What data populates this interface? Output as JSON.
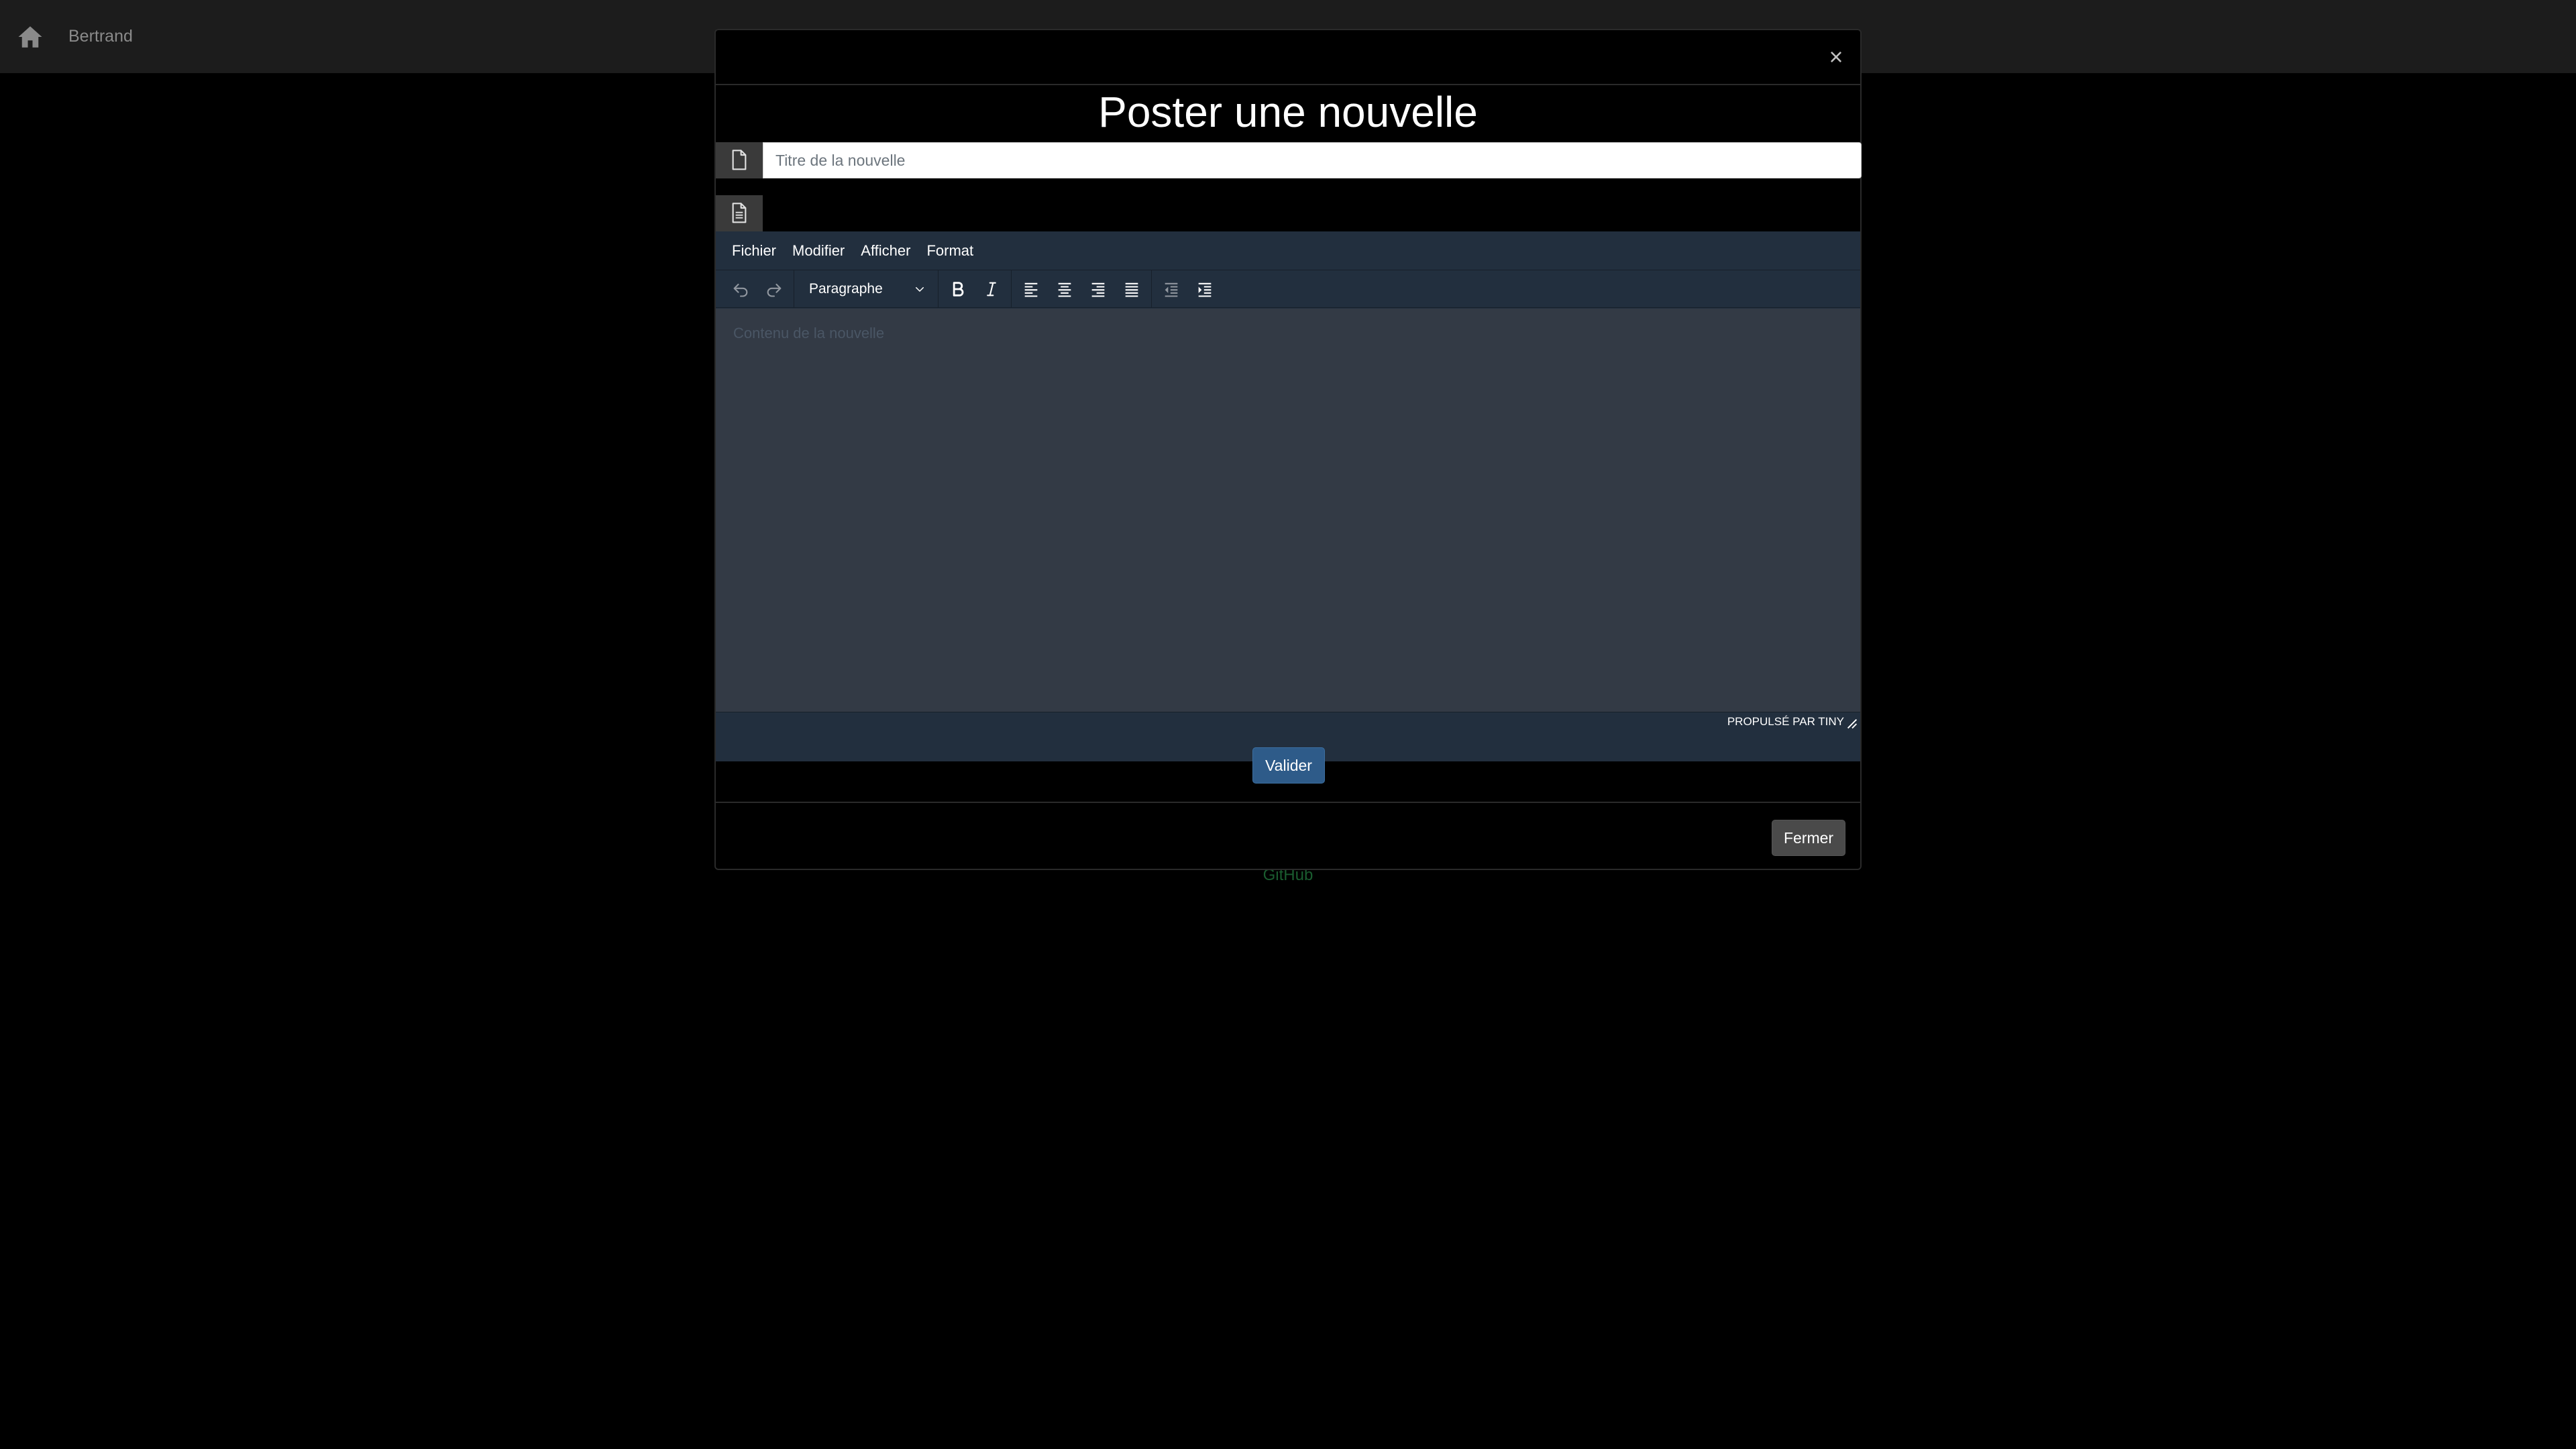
{
  "navbar": {
    "user_name": "Bertrand"
  },
  "footer": {
    "link_text": "GitHub"
  },
  "modal": {
    "close_symbol": "×",
    "title": "Poster une nouvelle",
    "title_input": {
      "placeholder": "Titre de la nouvelle",
      "value": ""
    },
    "editor": {
      "menu": [
        "Fichier",
        "Modifier",
        "Afficher",
        "Format"
      ],
      "block_format": "Paragraphe",
      "content_placeholder": "Contenu de la nouvelle",
      "branding": "Propulsé par Tiny"
    },
    "submit_label": "Valider",
    "close_label": "Fermer"
  },
  "colors": {
    "background": "#000000",
    "navbar": "#1c1c1c",
    "editor_chrome": "#222f3e",
    "editor_area": "#333a45",
    "primary_button": "#2e5b89",
    "secondary_button": "#4a4a4a",
    "footer_link": "#1a5c2f"
  },
  "icons": {
    "home": "home-icon",
    "title_addon": "file-icon",
    "content_addon": "file-text-icon",
    "toolbar": [
      "undo-icon",
      "redo-icon",
      "bold-icon",
      "italic-icon",
      "align-left-icon",
      "align-center-icon",
      "align-right-icon",
      "align-justify-icon",
      "outdent-icon",
      "indent-icon"
    ]
  }
}
